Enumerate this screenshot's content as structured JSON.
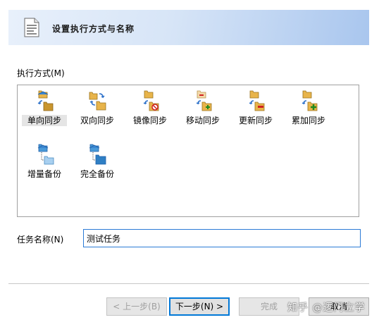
{
  "header": {
    "title": "设置执行方式与名称"
  },
  "mode": {
    "label": "执行方式(M)",
    "items": [
      {
        "label": "单向同步",
        "icon": "one-way-sync-icon",
        "selected": true
      },
      {
        "label": "双向同步",
        "icon": "two-way-sync-icon",
        "selected": false
      },
      {
        "label": "镜像同步",
        "icon": "mirror-sync-icon",
        "selected": false
      },
      {
        "label": "移动同步",
        "icon": "move-sync-icon",
        "selected": false
      },
      {
        "label": "更新同步",
        "icon": "update-sync-icon",
        "selected": false
      },
      {
        "label": "累加同步",
        "icon": "accumulate-sync-icon",
        "selected": false
      },
      {
        "label": "增量备份",
        "icon": "incremental-backup-icon",
        "selected": false
      },
      {
        "label": "完全备份",
        "icon": "full-backup-icon",
        "selected": false
      }
    ]
  },
  "task_name": {
    "label": "任务名称(N)",
    "value": "测试任务"
  },
  "buttons": {
    "prev": "< 上一步(B)",
    "next": "下一步(N) >",
    "finish": "完成",
    "cancel": "取消"
  },
  "watermark": "知乎 @逻门立学",
  "colors": {
    "folder": "#e8b44a",
    "blue_folder": "#4a9ad8",
    "arrow": "#2a6fc9",
    "focus_border": "#0078d7"
  }
}
